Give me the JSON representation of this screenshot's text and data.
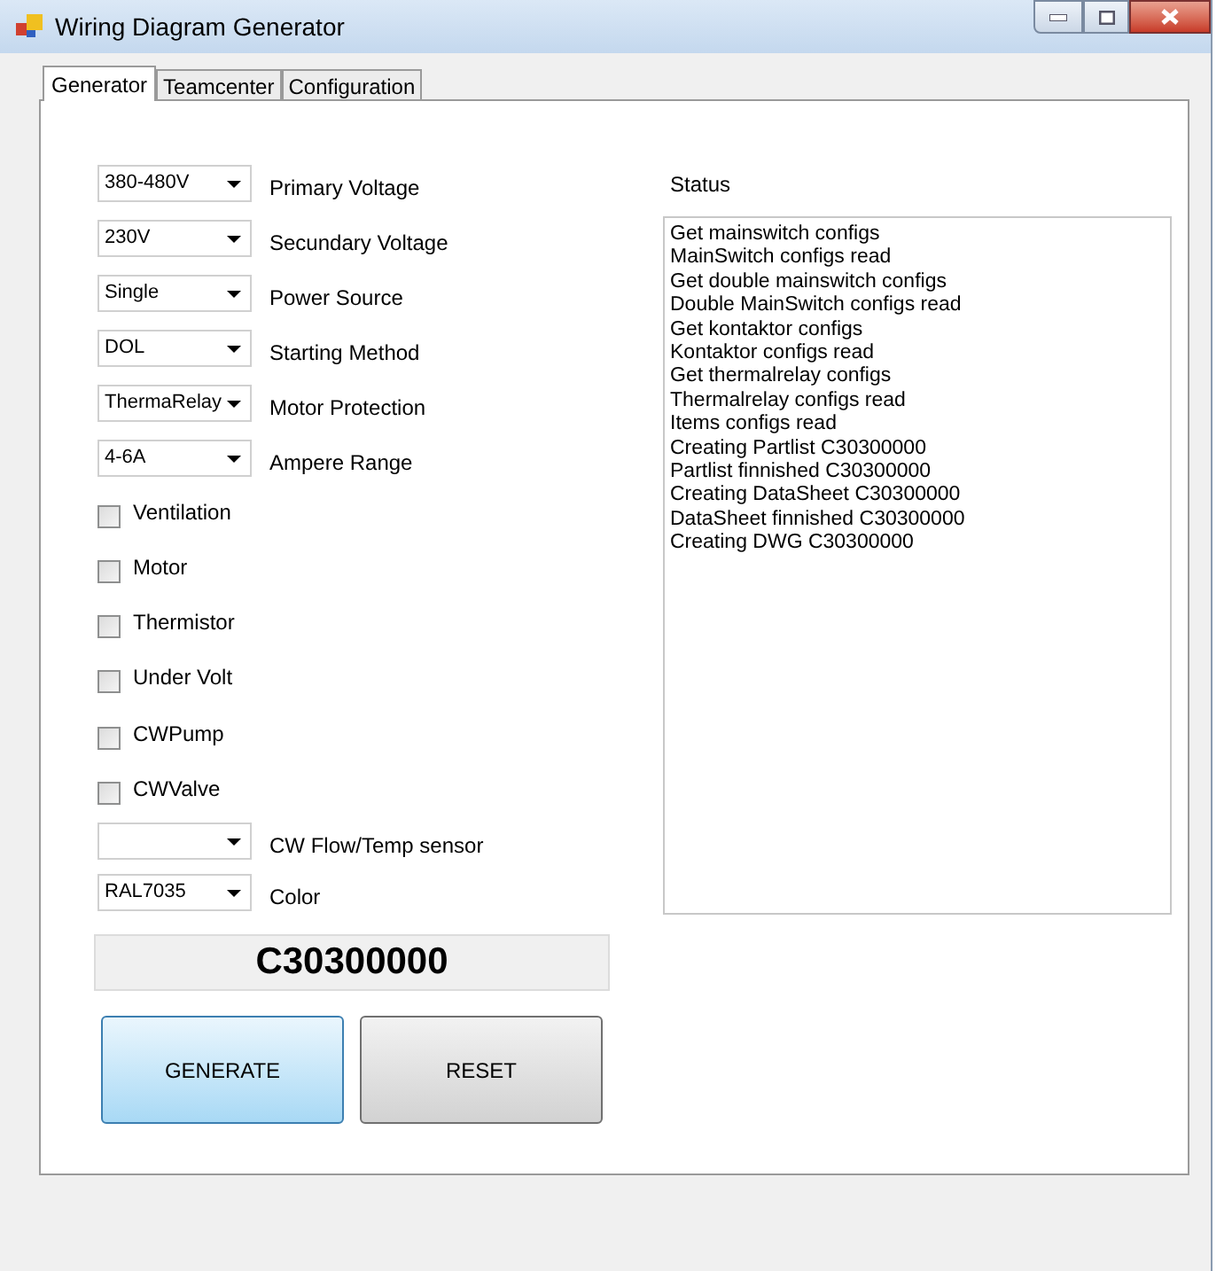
{
  "window": {
    "title": "Wiring Diagram Generator"
  },
  "tabs": [
    {
      "label": "Generator",
      "selected": true
    },
    {
      "label": "Teamcenter",
      "selected": false
    },
    {
      "label": "Configuration",
      "selected": false
    }
  ],
  "form": [
    {
      "kind": "combo",
      "value": "380-480V",
      "label": "Primary Voltage"
    },
    {
      "kind": "combo",
      "value": "230V",
      "label": "Secundary Voltage"
    },
    {
      "kind": "combo",
      "value": "Single",
      "label": "Power Source"
    },
    {
      "kind": "combo",
      "value": "DOL",
      "label": "Starting Method"
    },
    {
      "kind": "combo",
      "value": "ThermaRelay",
      "label": "Motor Protection"
    },
    {
      "kind": "combo",
      "value": "4-6A",
      "label": "Ampere Range"
    },
    {
      "kind": "checkbox",
      "label": "Ventilation",
      "checked": false
    },
    {
      "kind": "checkbox",
      "label": "Motor",
      "checked": false
    },
    {
      "kind": "checkbox",
      "label": "Thermistor",
      "checked": false
    },
    {
      "kind": "checkbox",
      "label": "Under Volt",
      "checked": false
    },
    {
      "kind": "checkbox",
      "label": "CWPump",
      "checked": false
    },
    {
      "kind": "checkbox",
      "label": "CWValve",
      "checked": false
    },
    {
      "kind": "combo2",
      "label": "CW Flow/Temp sensor"
    },
    {
      "kind": "combo2",
      "value": "RAL7035",
      "label": "Color"
    }
  ],
  "code": "C30300000",
  "buttons": [
    {
      "label": "GENERATE",
      "selected": true
    },
    {
      "label": "RESET",
      "selected": false
    }
  ],
  "status": {
    "label": "Status",
    "lines": [
      "Get mainswitch configs",
      "MainSwitch configs read",
      "Get double mainswitch configs",
      "Double MainSwitch configs read",
      "Get kontaktor configs",
      "Kontaktor configs read",
      "Get thermalrelay configs",
      "Thermalrelay configs read",
      "Items configs read",
      "Creating Partlist C30300000",
      "Partlist finnished C30300000",
      "Creating DataSheet C30300000",
      "DataSheet finnished C30300000",
      "Creating DWG C30300000"
    ]
  }
}
